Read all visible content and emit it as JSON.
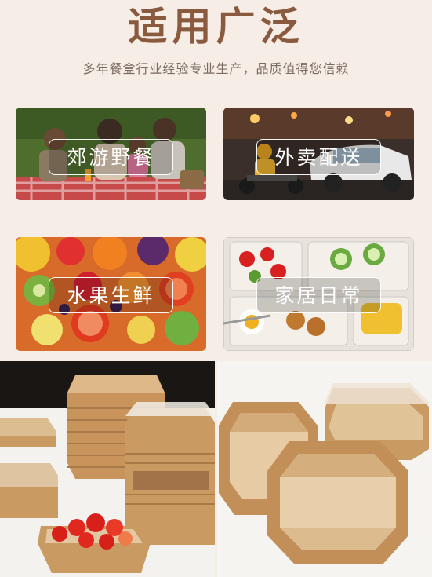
{
  "header": {
    "title": "适用广泛",
    "subtitle": "多年餐盒行业经验专业生产，品质值得您信赖"
  },
  "scenes": [
    {
      "label": "郊游野餐",
      "icon": "picnic-photo"
    },
    {
      "label": "外卖配送",
      "icon": "delivery-photo"
    },
    {
      "label": "水果生鲜",
      "icon": "fruit-photo"
    },
    {
      "label": "家居日常",
      "icon": "home-meal-photo"
    }
  ],
  "colors": {
    "title": "#8a5a3e",
    "background": "#f5ede6",
    "kraft": "#c9a06a"
  }
}
